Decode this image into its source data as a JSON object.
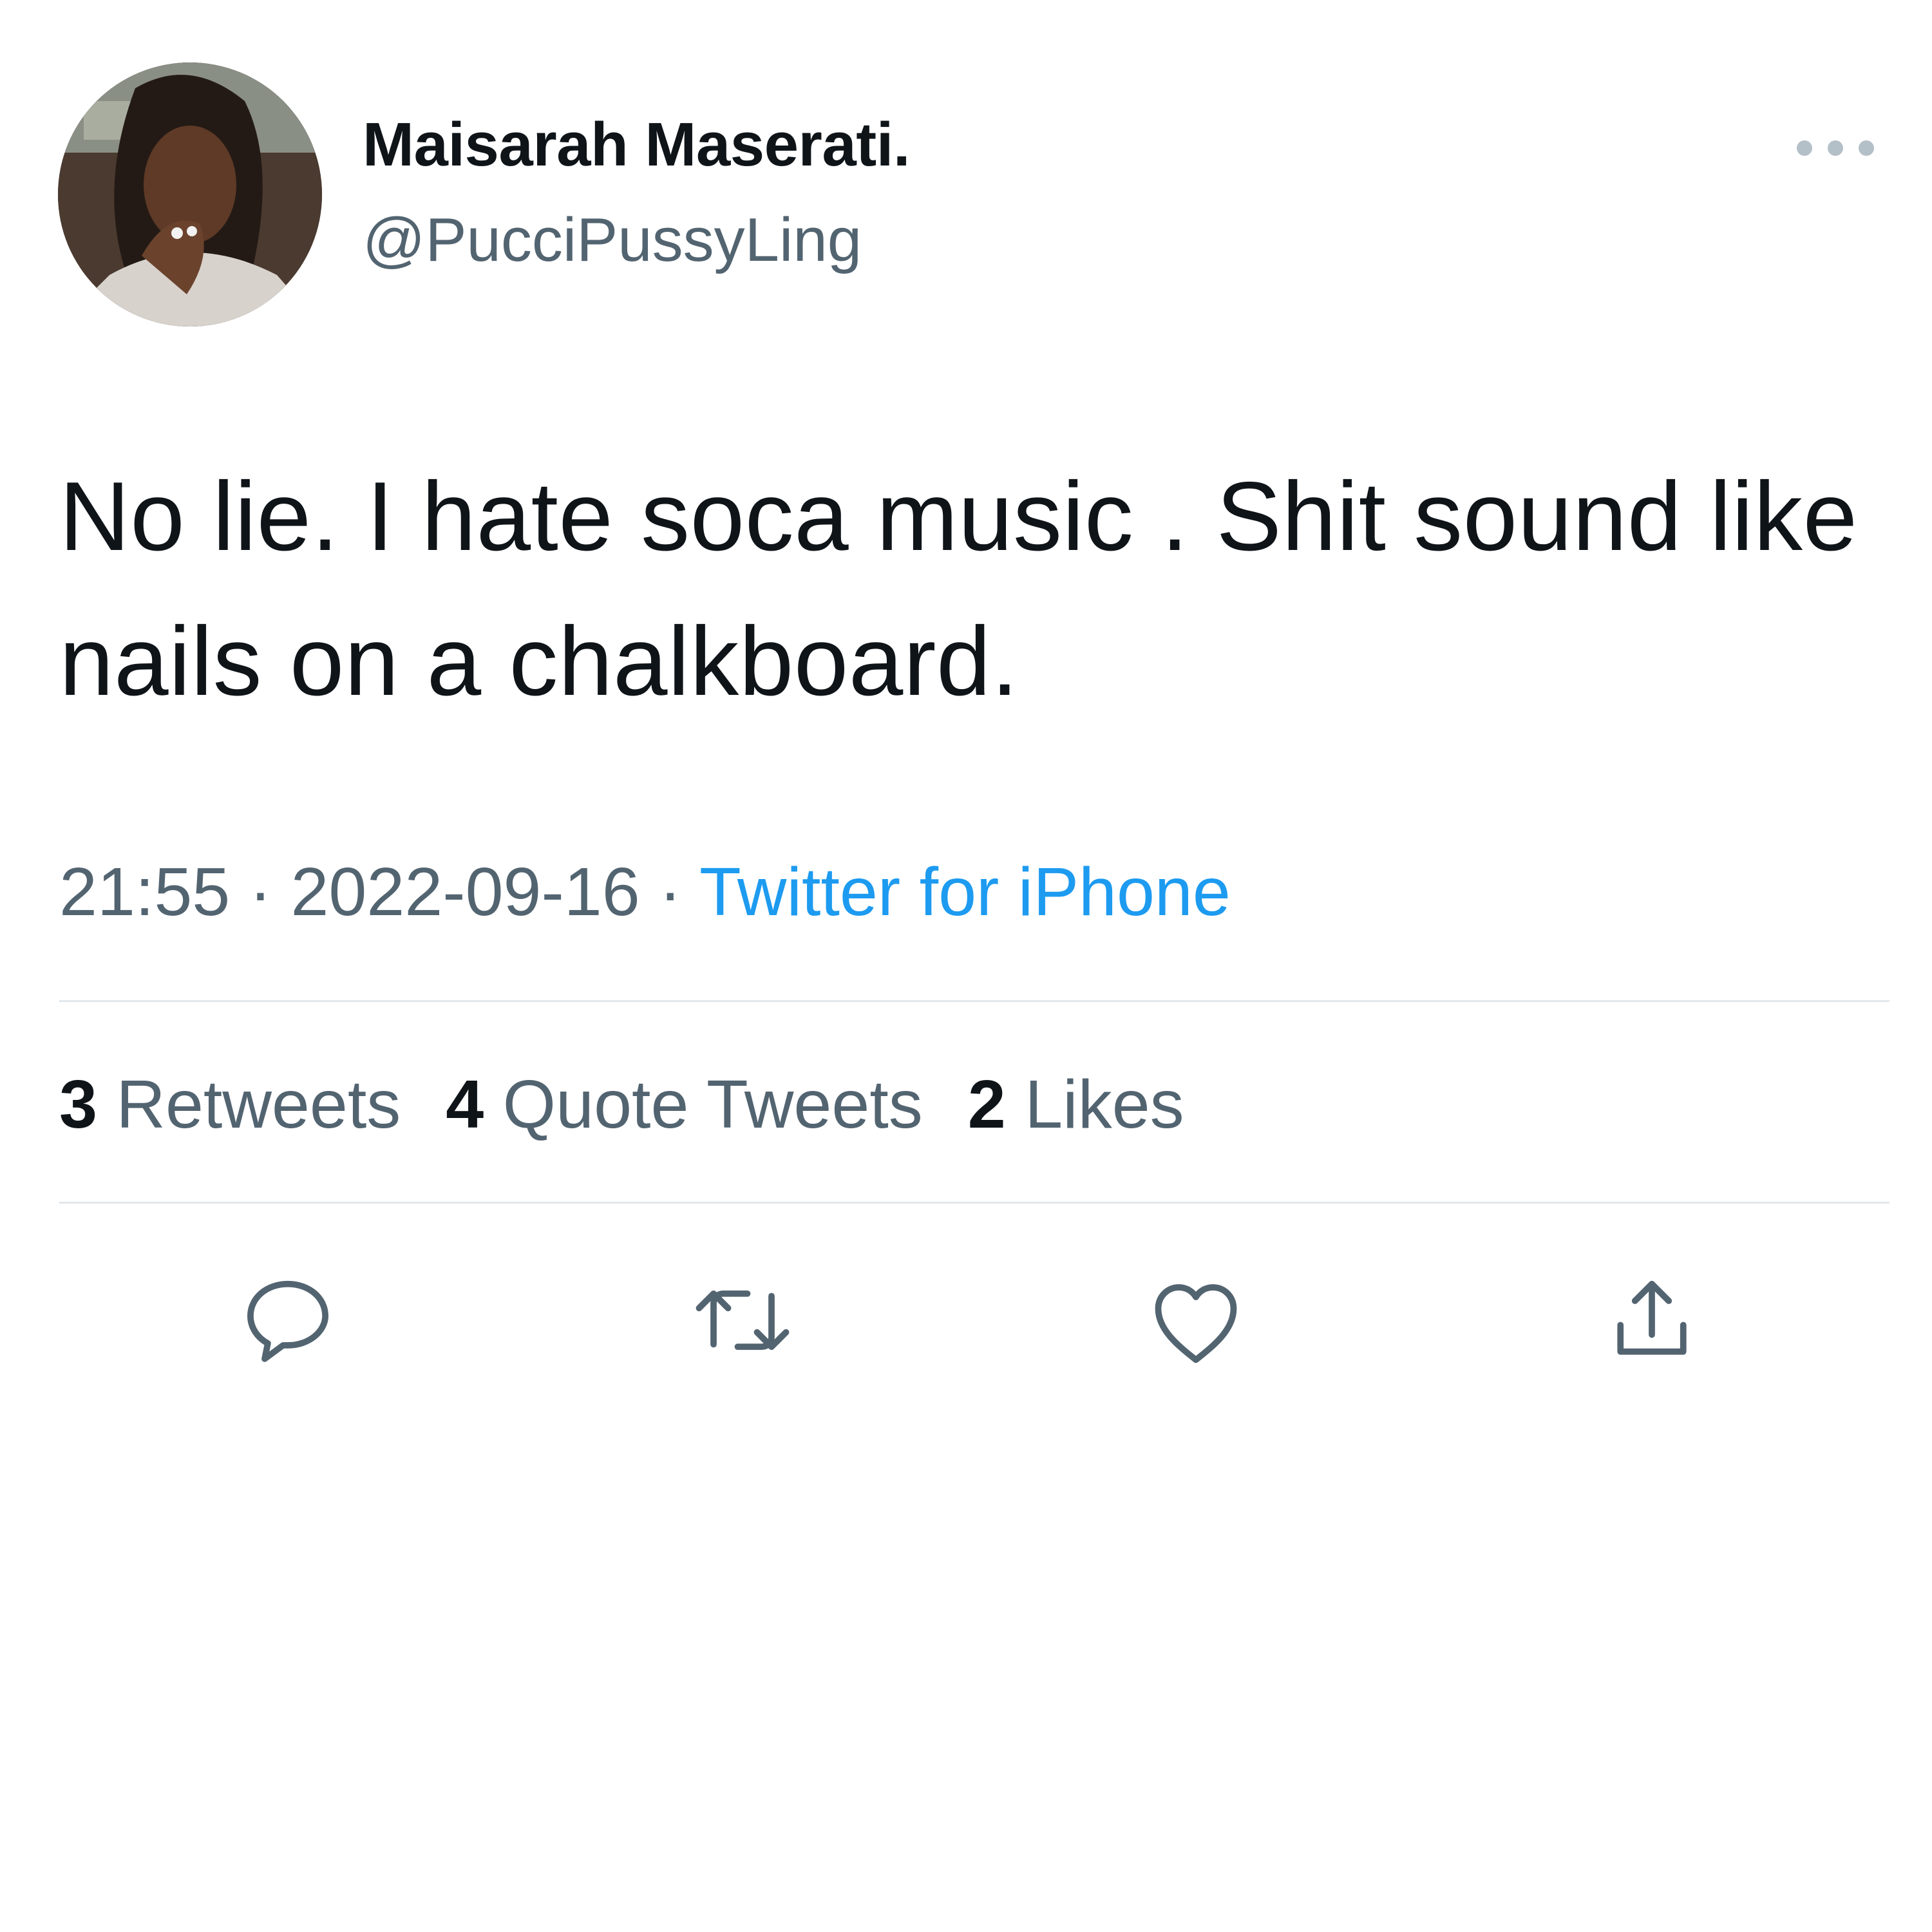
{
  "author": {
    "display_name": "Maisarah Maserati.",
    "handle": "@PucciPussyLing"
  },
  "tweet": {
    "text": "No lie. I hate soca music . Shit sound like nails on a chalkboard.",
    "time": "21:55",
    "separator": "·",
    "date": "2022-09-16",
    "source": "Twitter for iPhone"
  },
  "stats": {
    "retweets_count": "3",
    "retweets_label": "Retweets",
    "quotes_count": "4",
    "quotes_label": "Quote Tweets",
    "likes_count": "2",
    "likes_label": "Likes"
  },
  "icons": {
    "reply": "reply-icon",
    "retweet": "retweet-icon",
    "like": "heart-icon",
    "share": "share-icon",
    "more": "more-icon"
  },
  "colors": {
    "text": "#0f1419",
    "secondary": "#536471",
    "link": "#1d9bf0",
    "divider": "#e1e8ed"
  }
}
